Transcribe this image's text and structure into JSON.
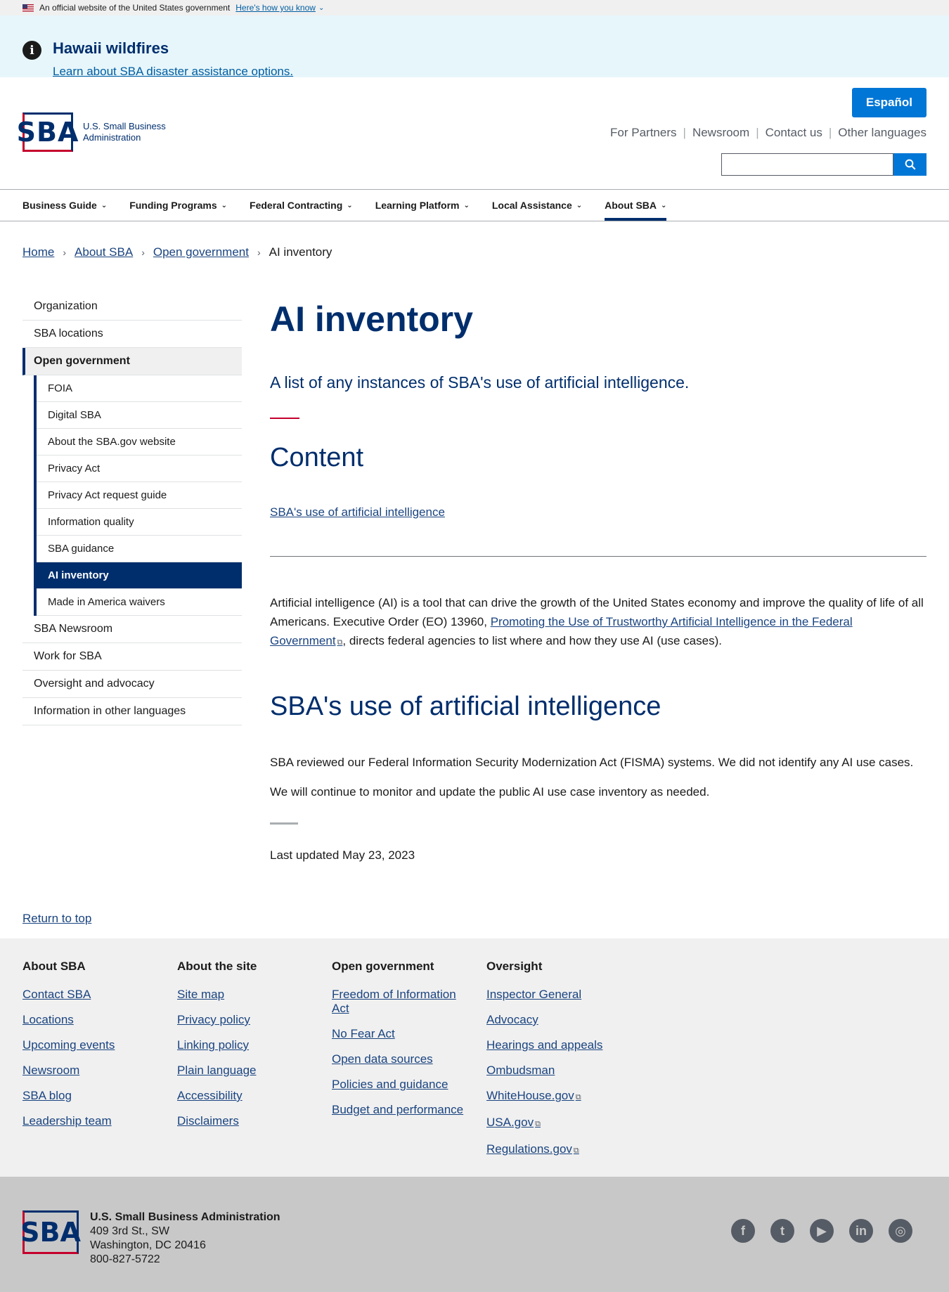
{
  "gov_banner": {
    "text": "An official website of the United States government",
    "link": "Here's how you know"
  },
  "alert": {
    "title": "Hawaii wildfires",
    "link": "Learn about SBA disaster assistance options."
  },
  "header": {
    "logo_mark": "SBA",
    "logo_text_line1": "U.S. Small Business",
    "logo_text_line2": "Administration",
    "espanol": "Español",
    "util_nav": [
      "For Partners",
      "Newsroom",
      "Contact us",
      "Other languages"
    ]
  },
  "main_nav": [
    "Business Guide",
    "Funding Programs",
    "Federal Contracting",
    "Learning Platform",
    "Local Assistance",
    "About SBA"
  ],
  "breadcrumb": [
    "Home",
    "About SBA",
    "Open government",
    "AI inventory"
  ],
  "sidebar": {
    "top": [
      "Organization",
      "SBA locations",
      "Open government"
    ],
    "sub": [
      "FOIA",
      "Digital SBA",
      "About the SBA.gov website",
      "Privacy Act",
      "Privacy Act request guide",
      "Information quality",
      "SBA guidance",
      "AI inventory",
      "Made in America waivers"
    ],
    "bottom": [
      "SBA Newsroom",
      "Work for SBA",
      "Oversight and advocacy",
      "Information in other languages"
    ]
  },
  "content": {
    "title": "AI inventory",
    "intro": "A list of any instances of SBA's use of artificial intelligence.",
    "toc_title": "Content",
    "toc_link": "SBA's use of artificial intelligence",
    "body_pre": "Artificial intelligence (AI) is a tool that can drive the growth of the United States economy and improve the quality of life of all Americans. Executive Order (EO) 13960, ",
    "body_link": "Promoting the Use of Trustworthy Artificial Intelligence in the Federal Government",
    "body_post": ", directs federal agencies to list where and how they use AI (use cases).",
    "section_title": "SBA's use of artificial intelligence",
    "p2": "SBA reviewed our Federal Information Security Modernization Act (FISMA) systems. We did not identify any AI use cases.",
    "p3": "We will continue to monitor and update the public AI use case inventory as needed.",
    "updated": "Last updated May 23, 2023"
  },
  "return_top": "Return to top",
  "footer": {
    "columns": [
      {
        "heading": "About SBA",
        "links": [
          "Contact SBA",
          "Locations",
          "Upcoming events",
          "Newsroom",
          "SBA blog",
          "Leadership team"
        ]
      },
      {
        "heading": "About the site",
        "links": [
          "Site map",
          "Privacy policy",
          "Linking policy",
          "Plain language",
          "Accessibility",
          "Disclaimers"
        ]
      },
      {
        "heading": "Open government",
        "links": [
          "Freedom of Information Act",
          "No Fear Act",
          "Open data sources",
          "Policies and guidance",
          "Budget and performance"
        ]
      },
      {
        "heading": "Oversight",
        "links": [
          "Inspector General",
          "Advocacy",
          "Hearings and appeals",
          "Ombudsman",
          "WhiteHouse.gov",
          "USA.gov",
          "Regulations.gov"
        ]
      }
    ],
    "org": "U.S. Small Business Administration",
    "address1": "409 3rd St., SW",
    "address2": "Washington, DC 20416",
    "phone": "800-827-5722",
    "social_icons": [
      "facebook-icon",
      "twitter-icon",
      "youtube-icon",
      "linkedin-icon",
      "instagram-icon"
    ]
  }
}
